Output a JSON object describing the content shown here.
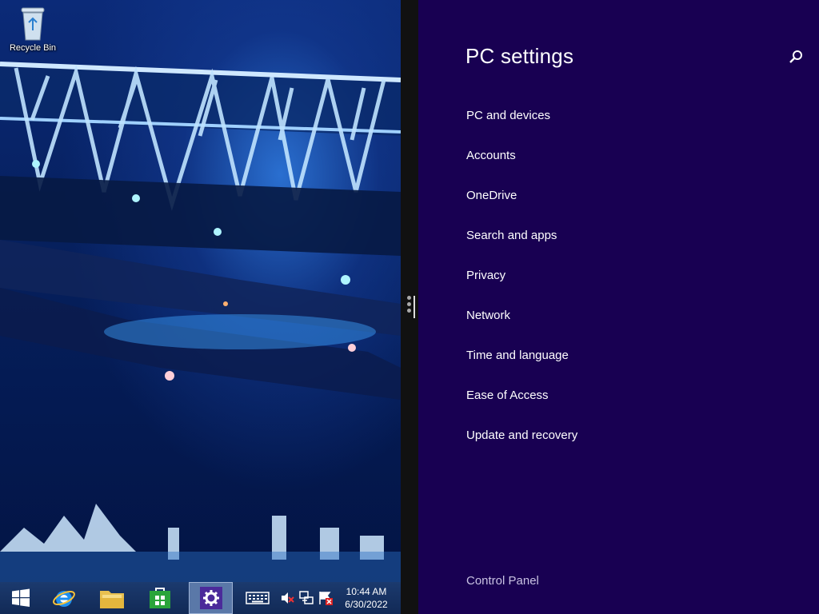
{
  "desktop": {
    "icons": [
      {
        "label": "Recycle Bin",
        "icon": "recycle-bin-icon"
      }
    ]
  },
  "settings": {
    "title": "PC settings",
    "search_icon": "search-icon",
    "items": [
      {
        "label": "PC and devices"
      },
      {
        "label": "Accounts"
      },
      {
        "label": "OneDrive"
      },
      {
        "label": "Search and apps"
      },
      {
        "label": "Privacy"
      },
      {
        "label": "Network"
      },
      {
        "label": "Time and language"
      },
      {
        "label": "Ease of Access"
      },
      {
        "label": "Update and recovery"
      }
    ],
    "footer_link": "Control Panel",
    "background_color": "#180052"
  },
  "taskbar": {
    "pinned": [
      {
        "name": "start",
        "icon": "windows-logo-icon"
      },
      {
        "name": "internet-explorer",
        "icon": "internet-explorer-icon"
      },
      {
        "name": "file-explorer",
        "icon": "folder-icon"
      },
      {
        "name": "store",
        "icon": "store-icon"
      },
      {
        "name": "pc-settings",
        "icon": "gear-icon",
        "active": true
      }
    ],
    "tray": [
      {
        "icon": "keyboard-icon"
      },
      {
        "icon": "volume-muted-icon"
      },
      {
        "icon": "network-icon"
      },
      {
        "icon": "action-center-icon"
      }
    ],
    "clock": {
      "time": "10:44 AM",
      "date": "6/30/2022"
    }
  }
}
